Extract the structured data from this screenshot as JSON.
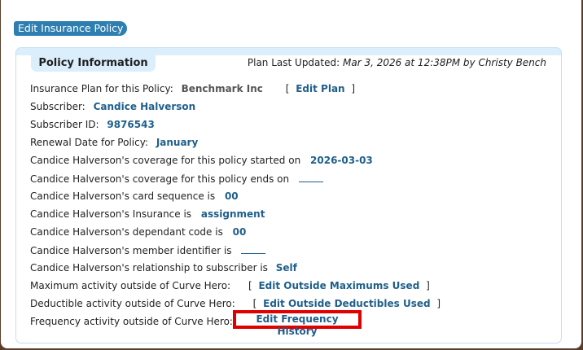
{
  "page": {
    "title": "Edit Insurance Policy"
  },
  "panel": {
    "tab_label": "Policy Information",
    "updated_label": "Plan Last Updated:",
    "updated_value": "Mar 3, 2026 at 12:38PM by Christy Bench"
  },
  "rows": {
    "plan_label": "Insurance Plan for this Policy:",
    "plan_value": "Benchmark Inc",
    "edit_plan": "Edit Plan",
    "subscriber_label": "Subscriber:",
    "subscriber_value": "Candice Halverson",
    "subscriber_id_label": "Subscriber ID:",
    "subscriber_id_value": "9876543",
    "renewal_label": "Renewal Date for Policy:",
    "renewal_value": "January",
    "started_label": "Candice Halverson's coverage for this policy started on",
    "started_value": "2026-03-03",
    "ends_label": "Candice Halverson's coverage for this policy ends on",
    "card_seq_label": "Candice Halverson's card sequence is",
    "card_seq_value": "00",
    "insurance_label": "Candice Halverson's Insurance is",
    "insurance_value": "assignment",
    "dependant_label": "Candice Halverson's dependant code is",
    "dependant_value": "00",
    "member_label": "Candice Halverson's member identifier is",
    "relationship_label": "Candice Halverson's relationship to subscriber is",
    "relationship_value": "Self",
    "max_label": "Maximum activity outside of Curve Hero:",
    "max_link": "Edit Outside Maximums Used",
    "deductible_label": "Deductible activity outside of Curve Hero:",
    "deductible_link": "Edit Outside Deductibles Used",
    "frequency_label": "Frequency activity outside of Curve Hero:",
    "frequency_link": "Edit Frequency History"
  },
  "colors": {
    "accent": "#2e7fb0",
    "link": "#1f5f8b",
    "panel_header": "#dbeefb",
    "highlight": "#e00000"
  }
}
